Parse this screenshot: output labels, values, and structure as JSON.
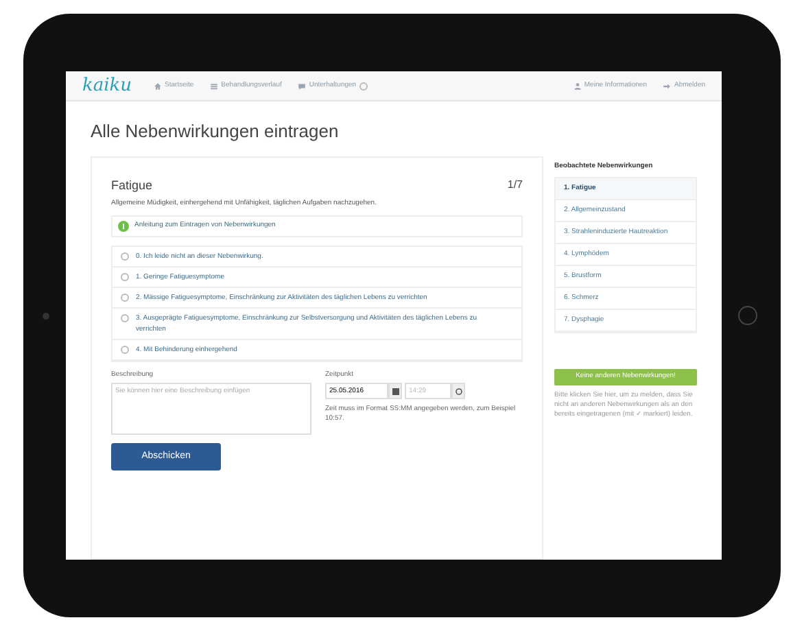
{
  "nav": {
    "logo": "kaiku",
    "items": [
      {
        "kind": "home",
        "label": "Startseite",
        "badge": false
      },
      {
        "kind": "list",
        "label": "Behandlungsverlauf",
        "badge": false
      },
      {
        "kind": "chat",
        "label": "Unterhaltungen",
        "badge": true
      }
    ],
    "right": [
      {
        "kind": "user",
        "label": "Meine Informationen"
      },
      {
        "kind": "logout",
        "label": "Abmelden"
      }
    ]
  },
  "page_title": "Alle Nebenwirkungen eintragen",
  "form": {
    "title": "Fatigue",
    "step": "1/7",
    "description": "Allgemeine Müdigkeit, einhergehend mit Unfähigkeit, täglichen Aufgaben nachzugehen.",
    "help": "Anleitung zum Eintragen von Nebenwirkungen",
    "options": [
      {
        "label": "0. Ich leide nicht an dieser Nebenwirkung.",
        "selected": false
      },
      {
        "label": "1. Geringe Fatiguesymptome",
        "selected": false
      },
      {
        "label": "2. Mässige Fatiguesymptome, Einschränkung zur Aktivitäten des täglichen Lebens zu verrichten",
        "selected": false
      },
      {
        "label": "3. Ausgeprägte Fatiguesymptome, Einschränkung zur Selbstversorgung und Aktivitäten des täglichen Lebens zu verrichten",
        "selected": false
      },
      {
        "label": "4. Mit Behinderung einhergehend",
        "selected": false
      }
    ],
    "description_label": "Beschreibung",
    "description_placeholder": "Sie können hier eine Beschreibung einfügen",
    "time_label": "Zeitpunkt",
    "date": "25.05.2016",
    "time_placeholder": "14:29",
    "time_hint": "Zeit muss im Format SS:MM angegeben werden, zum Beispiel 10:57.",
    "submit": "Abschicken"
  },
  "sidebar": {
    "title": "Beobachtete Nebenwirkungen",
    "items": [
      {
        "label": "1. Fatigue",
        "selected": true
      },
      {
        "label": "2. Allgemeinzustand",
        "selected": false
      },
      {
        "label": "3. Strahleninduzierte Hautreaktion",
        "selected": false
      },
      {
        "label": "4. Lymphödem",
        "selected": false
      },
      {
        "label": "5. Brustform",
        "selected": false
      },
      {
        "label": "6. Schmerz",
        "selected": false
      },
      {
        "label": "7. Dysphagie",
        "selected": false
      }
    ],
    "button": "Keine anderen Nebenwirkungen!",
    "note": "Bitte klicken Sie hier, um zu melden, dass Sie nicht an anderen Nebenwirkungen als an den bereits eingetragenen (mit ✓ markiert) leiden."
  }
}
